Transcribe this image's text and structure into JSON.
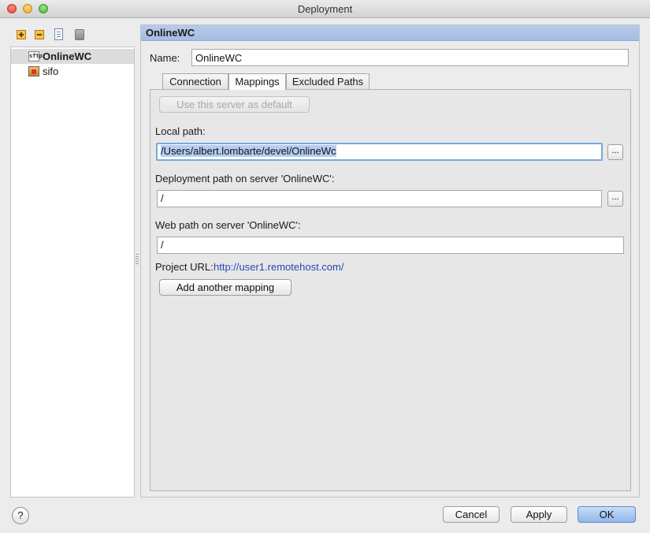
{
  "window": {
    "title": "Deployment"
  },
  "tree": {
    "items": [
      {
        "label": "OnlineWC",
        "icon": "sftp-server-icon",
        "icon_text": "sftp"
      },
      {
        "label": "sifo",
        "icon": "local-folder-icon"
      }
    ]
  },
  "panel": {
    "header": "OnlineWC",
    "name_label": "Name:",
    "name_value": "OnlineWC"
  },
  "tabs": [
    {
      "label": "Connection"
    },
    {
      "label": "Mappings"
    },
    {
      "label": "Excluded Paths"
    }
  ],
  "mappings": {
    "default_button": "Use this server as default",
    "local_path_label": "Local path:",
    "local_path_value": "/Users/albert.lombarte/devel/OnlineWc",
    "deployment_path_label": "Deployment path on server 'OnlineWC':",
    "deployment_path_value": "/",
    "web_path_label": "Web path on server 'OnlineWC':",
    "web_path_value": "/",
    "project_url_label": "Project URL:",
    "project_url_value": "http://user1.remotehost.com/",
    "browse_label": "...",
    "add_mapping_button": "Add another mapping"
  },
  "footer": {
    "help": "?",
    "cancel": "Cancel",
    "apply": "Apply",
    "ok": "OK"
  }
}
